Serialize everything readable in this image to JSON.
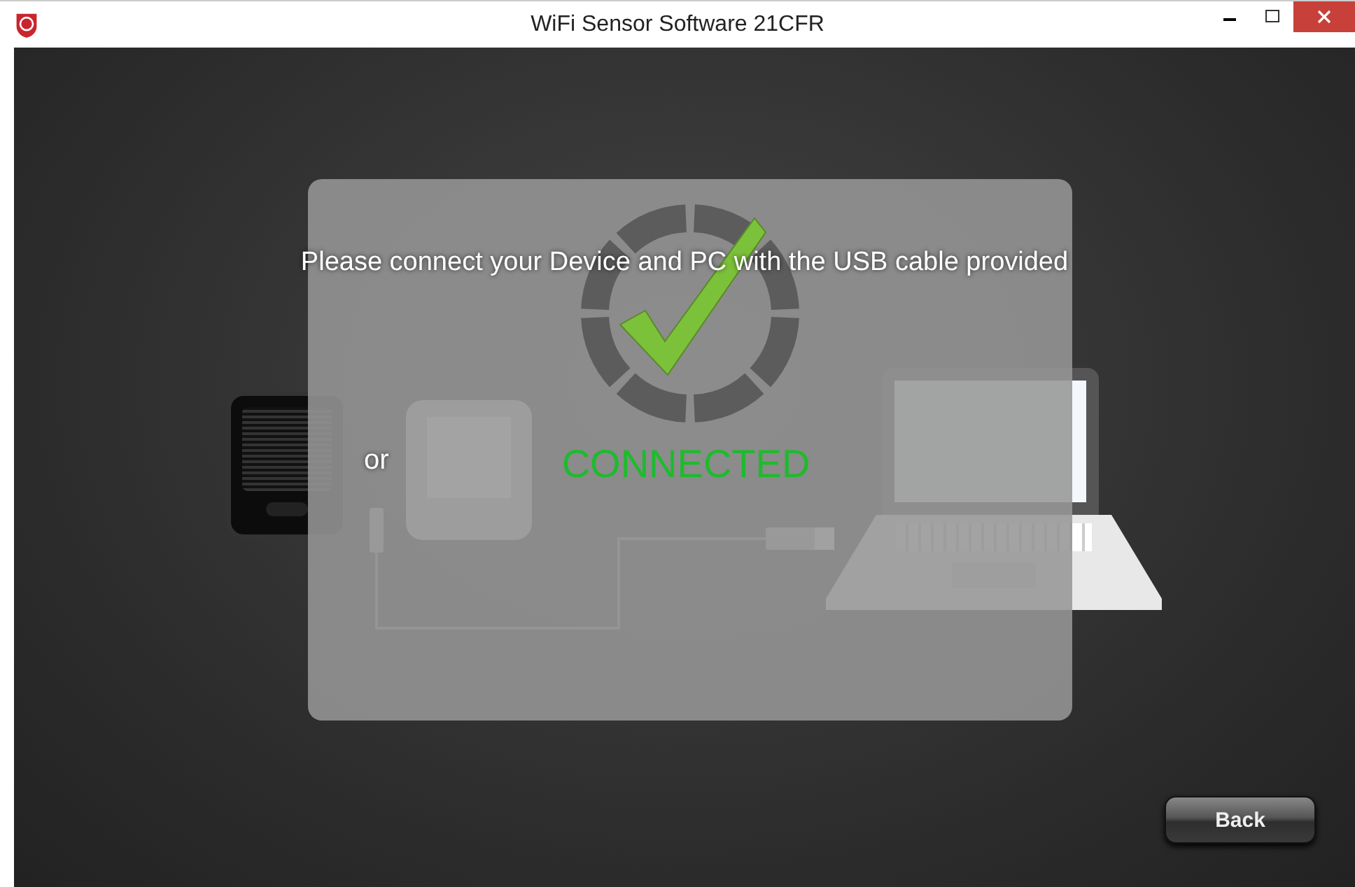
{
  "window": {
    "title": "WiFi Sensor Software 21CFR"
  },
  "instruction": "Please connect your Device and PC with the USB cable provided",
  "device_separator": "or",
  "connection": {
    "status": "CONNECTED",
    "connected": true
  },
  "back_button": {
    "label": "Back"
  }
}
